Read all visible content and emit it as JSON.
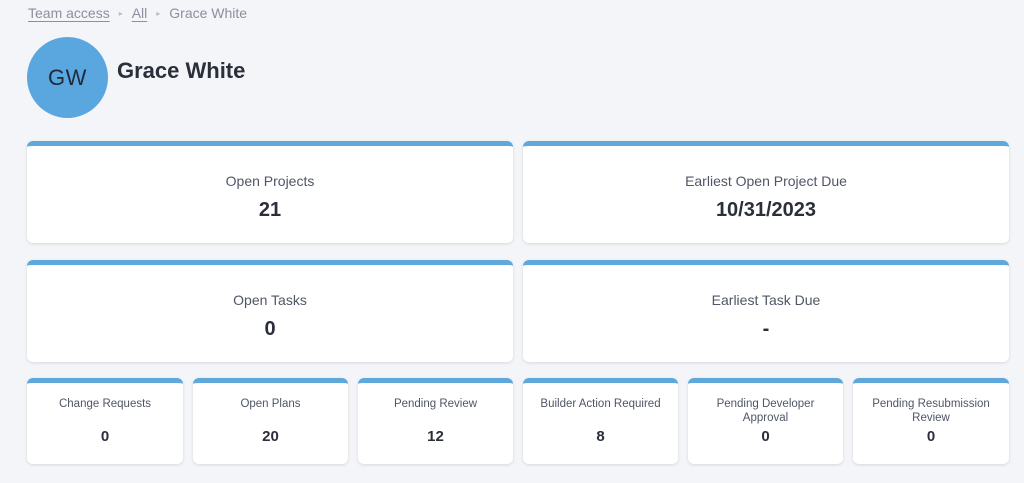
{
  "breadcrumb": {
    "items": [
      "Team access",
      "All"
    ],
    "current": "Grace White"
  },
  "profile": {
    "initials": "GW",
    "name": "Grace White",
    "avatar_color": "#5aa7e0"
  },
  "accent_color": "#5fa8dc",
  "summary_cards": [
    {
      "label": "Open Projects",
      "value": "21"
    },
    {
      "label": "Earliest Open Project Due",
      "value": "10/31/2023"
    },
    {
      "label": "Open Tasks",
      "value": "0"
    },
    {
      "label": "Earliest Task Due",
      "value": "-"
    }
  ],
  "status_cards": [
    {
      "label": "Change Requests",
      "value": "0"
    },
    {
      "label": "Open Plans",
      "value": "20"
    },
    {
      "label": "Pending Review",
      "value": "12"
    },
    {
      "label": "Builder Action Required",
      "value": "8"
    },
    {
      "label": "Pending Developer Approval",
      "value": "0"
    },
    {
      "label": "Pending Resubmission Review",
      "value": "0"
    }
  ]
}
